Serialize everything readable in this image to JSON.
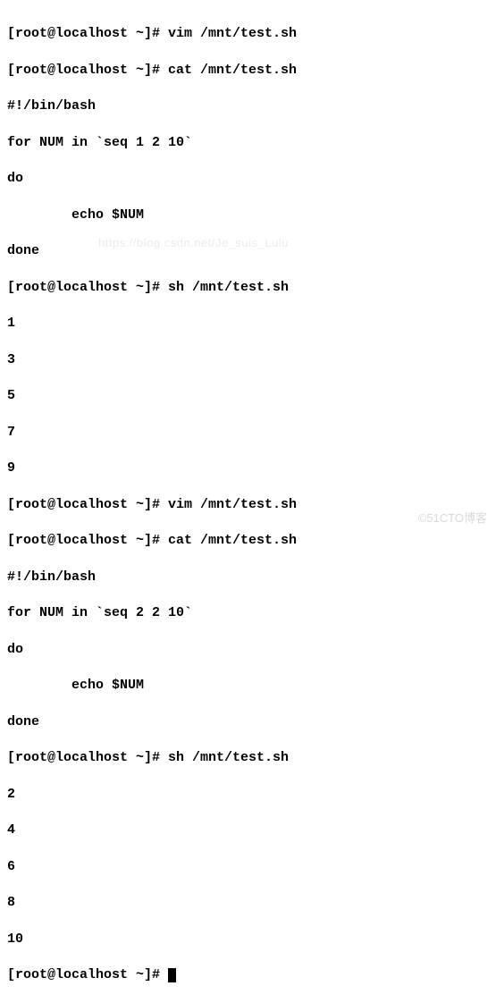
{
  "prompt": "[root@localhost ~]# ",
  "cmds": {
    "vim": "vim /mnt/test.sh",
    "cat": "cat /mnt/test.sh",
    "sh": "sh /mnt/test.sh"
  },
  "script1": {
    "shebang": "#!/bin/bash",
    "forline": "for NUM in `seq 1 2 10`",
    "do": "do",
    "body": "        echo $NUM",
    "done": "done"
  },
  "out1": {
    "l1": "1",
    "l2": "3",
    "l3": "5",
    "l4": "7",
    "l5": "9"
  },
  "script2": {
    "shebang": "#!/bin/bash",
    "forline": "for NUM in `seq 2 2 10`",
    "do": "do",
    "body": "        echo $NUM",
    "done": "done"
  },
  "out2": {
    "l1": "2",
    "l2": "4",
    "l3": "6",
    "l4": "8",
    "l5": "10"
  },
  "watermark": "©51CTO博客",
  "faint": "https://blog.csdn.net/Je_suis_Lulu"
}
